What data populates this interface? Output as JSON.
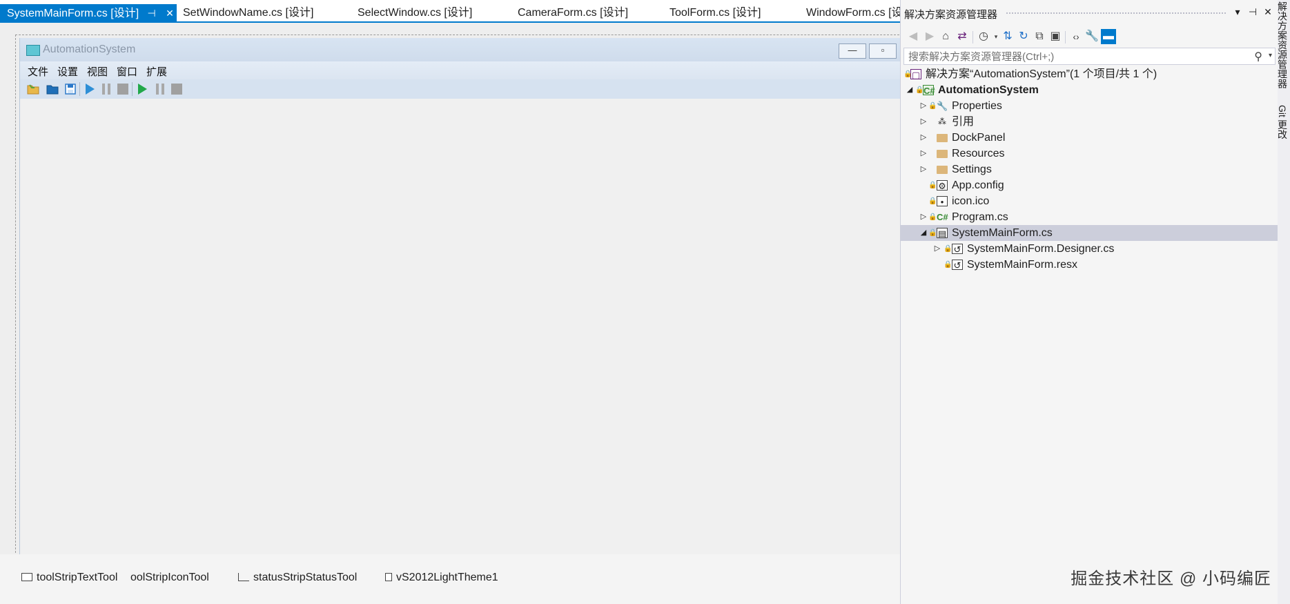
{
  "tabs": [
    {
      "label": "SystemMainForm.cs [设计]",
      "pin": "⊣",
      "close": "✕"
    },
    {
      "label": "SetWindowName.cs [设计]"
    },
    {
      "label": "SelectWindow.cs [设计]"
    },
    {
      "label": "CameraForm.cs [设计]"
    },
    {
      "label": "ToolForm.cs [设计]"
    },
    {
      "label": "WindowForm.cs [设"
    }
  ],
  "designer": {
    "form_title": "AutomationSystem",
    "window_buttons": {
      "minimize": "—",
      "restore": "▫"
    },
    "menu": [
      "文件",
      "设置",
      "视图",
      "窗口",
      "扩展"
    ],
    "toolbar_icons": [
      "open-folder-icon",
      "folder-icon",
      "save-icon",
      "play-icon",
      "pause-icon",
      "stop-icon",
      "play-green-icon",
      "pause-icon",
      "stop-icon"
    ],
    "tray": [
      {
        "label": "toolStripTextTool",
        "icon": "toolstrip-icon"
      },
      {
        "label": "oolStripIconTool"
      },
      {
        "label": "statusStripStatusTool",
        "icon": "statusstrip-icon"
      },
      {
        "label": "vS2012LightTheme1",
        "icon": "theme-component-icon"
      }
    ]
  },
  "solution_explorer": {
    "title": "解决方案资源管理器",
    "header_buttons": {
      "dropdown": "▾",
      "pin": "⊣",
      "close": "✕"
    },
    "toolbar": [
      "back-icon",
      "forward-icon",
      "home-icon",
      "switch-views-icon",
      "pending-changes-icon",
      "sync-icon",
      "refresh-icon",
      "collapse-all-icon",
      "show-all-files-icon",
      "view-code-icon",
      "properties-icon",
      "preview-icon"
    ],
    "search_placeholder": "搜索解决方案资源管理器(Ctrl+;)",
    "tree": [
      {
        "label": "解决方案“AutomationSystem”(1 个项目/共 1 个)",
        "icon": "solution-icon"
      },
      {
        "label": "AutomationSystem",
        "icon": "csharp-project-icon",
        "bold": true
      },
      {
        "label": "Properties",
        "icon": "wrench-icon"
      },
      {
        "label": "引用",
        "icon": "references-icon"
      },
      {
        "label": "DockPanel",
        "icon": "folder-icon"
      },
      {
        "label": "Resources",
        "icon": "folder-icon"
      },
      {
        "label": "Settings",
        "icon": "folder-icon"
      },
      {
        "label": "App.config",
        "icon": "config-file-icon"
      },
      {
        "label": "icon.ico",
        "icon": "icon-file-icon"
      },
      {
        "label": "Program.cs",
        "icon": "csharp-file-icon"
      },
      {
        "label": "SystemMainForm.cs",
        "icon": "form-file-icon",
        "selected": true
      },
      {
        "label": "SystemMainForm.Designer.cs",
        "icon": "designer-file-icon"
      },
      {
        "label": "SystemMainForm.resx",
        "icon": "resx-file-icon"
      }
    ],
    "watermark": "掘金技术社区 @ 小码编匠"
  },
  "side_tabs": [
    "解决方案资源管理器",
    "Git 更改"
  ]
}
